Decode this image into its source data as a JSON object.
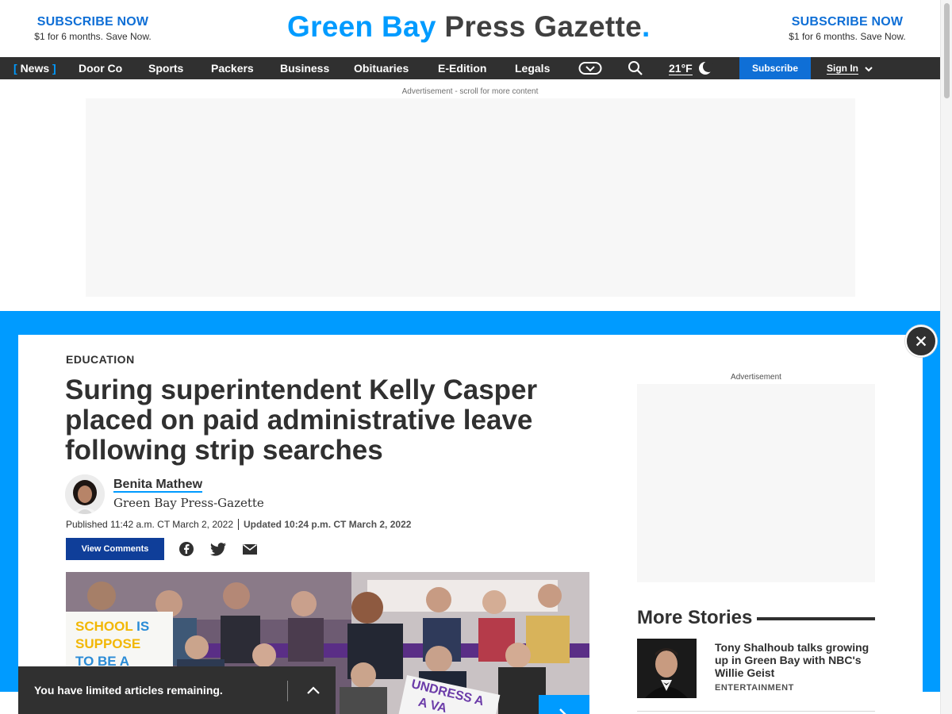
{
  "header": {
    "promo_left": {
      "line1": "SUBSCRIBE NOW",
      "line2": "$1 for 6 months. Save Now."
    },
    "promo_right": {
      "line1": "SUBSCRIBE NOW",
      "line2": "$1 for 6 months. Save Now."
    },
    "brand": {
      "part1": "Green Bay",
      "part2": " Press Gazette",
      "dot": "."
    }
  },
  "nav": {
    "bracket_open": "[",
    "bracket_close": "]",
    "items": [
      "News",
      "Door Co",
      "Sports",
      "Packers",
      "Business",
      "Obituaries",
      "E-Edition",
      "Legals"
    ],
    "temperature": "21°F",
    "subscribe_label": "Subscribe",
    "signin_label": "Sign In"
  },
  "ads": {
    "top_label": "Advertisement - scroll for more content",
    "side_label": "Advertisement"
  },
  "article": {
    "kicker": "EDUCATION",
    "headline": "Suring superintendent Kelly Casper placed on paid administrative leave following strip searches",
    "author": "Benita Mathew",
    "affiliation": "Green Bay Press-Gazette",
    "published": "Published 11:42 a.m. CT March 2, 2022",
    "updated": "Updated 10:24 p.m. CT March 2, 2022",
    "comments_label": "View Comments",
    "photo_sign1": [
      "SCHOOL IS",
      "SUPPOSE",
      "TO BE A"
    ],
    "photo_sign2": [
      "UNDRESS A",
      "A VA"
    ]
  },
  "sidebar": {
    "more_title": "More Stories",
    "stories": [
      {
        "title": "Tony Shalhoub talks growing up in Green Bay with NBC's Willie Geist",
        "category": "ENTERTAINMENT"
      }
    ]
  },
  "limited_bar": {
    "text": "You have limited articles remaining."
  },
  "colors": {
    "accent": "#009bff",
    "nav_bg": "#303030",
    "subscribe": "#0f6fd6",
    "comments_btn": "#0f3e99"
  }
}
